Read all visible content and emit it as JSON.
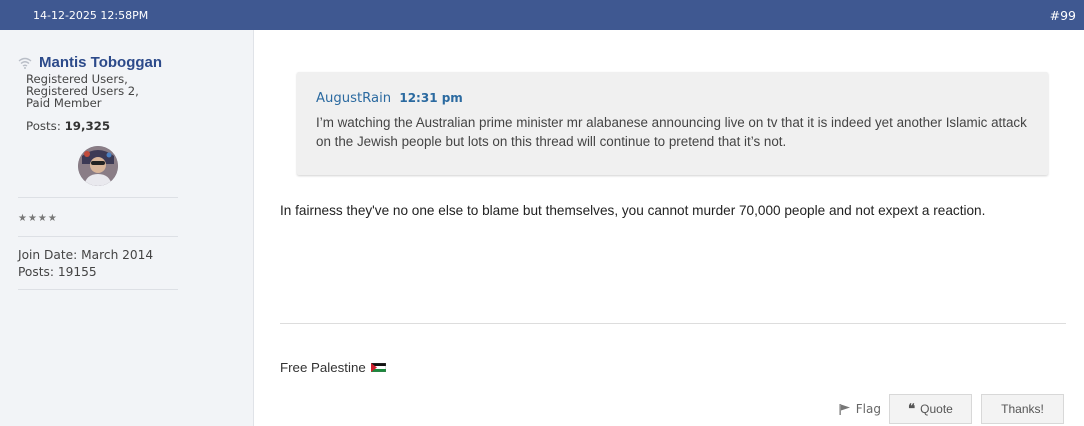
{
  "post": {
    "datetime": "14-12-2025 12:58PM",
    "number": "#99"
  },
  "user": {
    "name": "Mantis Toboggan",
    "groups": [
      "Registered Users,",
      "Registered Users 2,",
      "Paid Member"
    ],
    "posts_label": "Posts:",
    "posts_value": "19,325",
    "stars": "★★★★",
    "join_date": "Join Date: March 2014",
    "posts_count": "Posts: 19155",
    "icons": {
      "status": "wifi-icon",
      "avatar": "avatar"
    }
  },
  "quote": {
    "author": "AugustRain",
    "time": "12:31 pm",
    "text": "I’m watching the Australian prime minister mr alabanese announcing live on tv that it is indeed yet another Islamic attack on the Jewish people but lots on this thread will continue to pretend that it’s not."
  },
  "body": {
    "text": "In fairness they've no one else to blame but themselves, you cannot murder 70,000 people and not expext a reaction."
  },
  "signature": {
    "text": "Free Palestine",
    "flag_icon": "palestine-flag-icon"
  },
  "actions": {
    "flag_label": "Flag",
    "quote_label": "Quote",
    "thanks_label": "Thanks!"
  },
  "colors": {
    "header": "#3f5891",
    "username": "#2c4a8a",
    "quote_author": "#2b6aa0"
  }
}
